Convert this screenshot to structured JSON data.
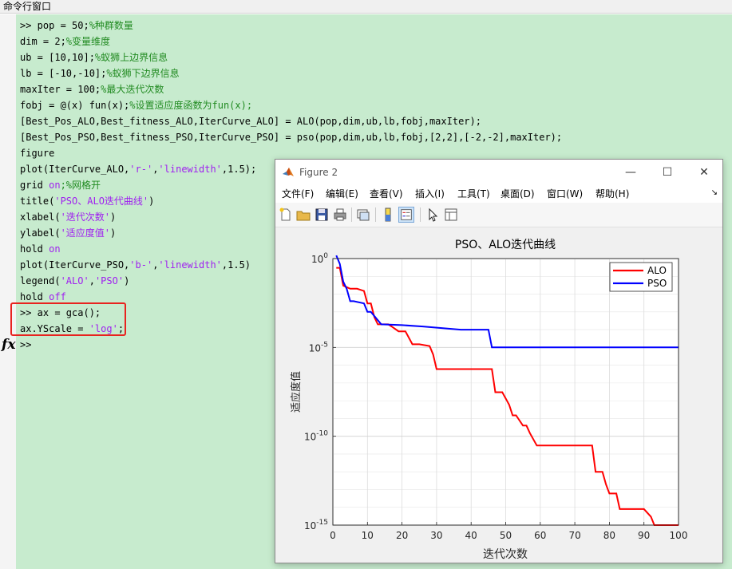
{
  "command_window": {
    "title": "命令行窗口",
    "prompt": ">>",
    "fx_symbol": "fx",
    "lines": [
      {
        "code": ">> pop = 50;",
        "comment": "%种群数量"
      },
      {
        "code": "dim = 2;",
        "comment": "%变量维度"
      },
      {
        "code": "ub = [10,10];",
        "comment": "%蚁狮上边界信息"
      },
      {
        "code": "lb = [-10,-10];",
        "comment": "%蚁狮下边界信息"
      },
      {
        "code": "maxIter = 100;",
        "comment": "%最大迭代次数"
      },
      {
        "code": "fobj = @(x) fun(x);",
        "comment": "%设置适应度函数为fun(x);"
      },
      {
        "code": "[Best_Pos_ALO,Best_fitness_ALO,IterCurve_ALO] = ALO(pop,dim,ub,lb,fobj,maxIter);"
      },
      {
        "code": "[Best_Pos_PSO,Best_fitness_PSO,IterCurve_PSO] = pso(pop,dim,ub,lb,fobj,[2,2],[-2,-2],maxIter);"
      },
      {
        "code": "figure"
      },
      {
        "pre": "plot(IterCurve_ALO,",
        "str1": "'r-'",
        "mid": ",",
        "str2": "'linewidth'",
        "post": ",1.5);"
      },
      {
        "pre": "grid ",
        "kw": "on",
        "comment": ";%网格开"
      },
      {
        "pre": "title(",
        "str1": "'PSO、ALO迭代曲线'",
        "post": ")"
      },
      {
        "pre": "xlabel(",
        "str1": "'迭代次数'",
        "post": ")"
      },
      {
        "pre": "ylabel(",
        "str1": "'适应度值'",
        "post": ")"
      },
      {
        "pre": "hold ",
        "kw": "on"
      },
      {
        "pre": "plot(IterCurve_PSO,",
        "str1": "'b-'",
        "mid": ",",
        "str2": "'linewidth'",
        "post": ",1.5)"
      },
      {
        "pre": "legend(",
        "str1": "'ALO'",
        "mid": ",",
        "str2": "'PSO'",
        "post": ")"
      },
      {
        "pre": "hold ",
        "kw": "off"
      },
      {
        "code": ">> ax = gca();"
      },
      {
        "pre": "ax.YScale = ",
        "str1": "'log'",
        "post": ";"
      }
    ]
  },
  "figure": {
    "window_title": "Figure 2",
    "menus": [
      "文件(F)",
      "编辑(E)",
      "查看(V)",
      "插入(I)",
      "工具(T)",
      "桌面(D)",
      "窗口(W)",
      "帮助(H)"
    ],
    "toolbar_icons": [
      "new-figure-icon",
      "open-file-icon",
      "save-icon",
      "print-icon",
      "link-plot-icon",
      "insert-colorbar-icon",
      "insert-legend-icon",
      "edit-plot-icon",
      "property-inspector-icon"
    ],
    "colors": {
      "alo": "#ff0000",
      "pso": "#0000ff",
      "axes_bg": "#ffffff",
      "figure_bg": "#f0f0f0"
    }
  },
  "chart_data": {
    "type": "line",
    "title": "PSO、ALO迭代曲线",
    "xlabel": "迭代次数",
    "ylabel": "适应度值",
    "xlim": [
      0,
      100
    ],
    "ylim_exp": [
      -15,
      0
    ],
    "yscale": "log",
    "grid": true,
    "legend_position": "top-right",
    "xticks": [
      "0",
      "10",
      "20",
      "30",
      "40",
      "50",
      "60",
      "70",
      "80",
      "90",
      "100"
    ],
    "yticks": [
      {
        "base": "10",
        "exp": "0"
      },
      {
        "base": "10",
        "exp": "-5"
      },
      {
        "base": "10",
        "exp": "-10"
      },
      {
        "base": "10",
        "exp": "-15"
      }
    ],
    "series": [
      {
        "name": "ALO",
        "color": "#ff0000",
        "x": [
          1,
          2,
          3,
          5,
          7,
          9,
          10,
          11,
          12,
          13,
          16,
          17,
          19,
          21,
          23,
          25,
          28,
          29,
          30,
          37,
          45,
          46,
          47,
          48,
          49,
          51,
          52,
          53,
          55,
          56,
          57,
          59,
          60,
          75,
          76,
          78,
          79,
          80,
          82,
          83,
          90,
          92,
          93,
          94,
          95,
          96,
          97,
          99,
          100
        ],
        "y": [
          0.3,
          0.3,
          0.03,
          0.02,
          0.02,
          0.015,
          0.003,
          0.003,
          0.0005,
          0.0002,
          0.0002,
          0.00015,
          8e-05,
          8e-05,
          1.5e-05,
          1.5e-05,
          1.2e-05,
          4e-06,
          6e-07,
          6e-07,
          6e-07,
          6e-07,
          3e-08,
          3e-08,
          3e-08,
          6e-09,
          1.5e-09,
          1.5e-09,
          4e-10,
          4e-10,
          1.5e-10,
          3e-11,
          3e-11,
          3e-11,
          1e-12,
          1e-12,
          2e-13,
          6e-14,
          6e-14,
          8e-15,
          8e-15,
          3e-15,
          1e-15,
          2e-16,
          5e-18,
          5e-20,
          5e-21,
          3e-22,
          8e-24
        ]
      },
      {
        "name": "PSO",
        "color": "#0000ff",
        "x": [
          1,
          2,
          3,
          4,
          5,
          6,
          9,
          10,
          11,
          14,
          20,
          26,
          37,
          44,
          45,
          46,
          100
        ],
        "y": [
          1.5,
          0.5,
          0.05,
          0.02,
          0.004,
          0.004,
          0.003,
          0.001,
          0.001,
          0.0002,
          0.00018,
          0.00015,
          0.0001,
          0.0001,
          0.0001,
          1e-05,
          1e-05
        ]
      }
    ]
  }
}
